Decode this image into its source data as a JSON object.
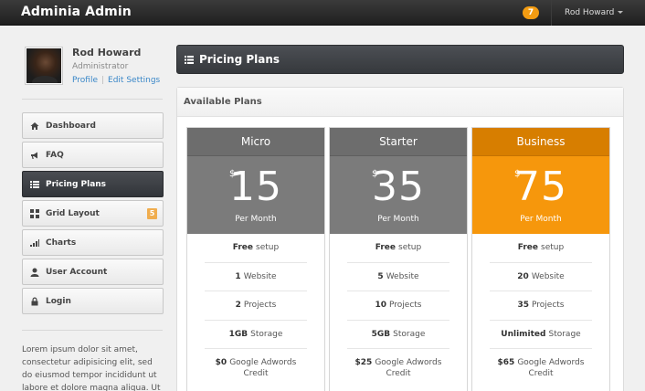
{
  "app": {
    "brand": "Adminia Admin",
    "notifications": "7",
    "user_menu": "Rod Howard"
  },
  "profile": {
    "name": "Rod Howard",
    "role": "Administrator",
    "link_profile": "Profile",
    "link_edit": "Edit Settings"
  },
  "sidebar": {
    "items": [
      {
        "label": "Dashboard",
        "icon": "home-icon"
      },
      {
        "label": "FAQ",
        "icon": "bullhorn-icon"
      },
      {
        "label": "Pricing Plans",
        "icon": "list-icon",
        "active": true
      },
      {
        "label": "Grid Layout",
        "icon": "grid-icon",
        "badge": "5"
      },
      {
        "label": "Charts",
        "icon": "signal-icon"
      },
      {
        "label": "User Account",
        "icon": "user-icon"
      },
      {
        "label": "Login",
        "icon": "lock-icon"
      }
    ],
    "lorem": "Lorem ipsum dolor sit amet, consectetur adipisicing elit, sed do eiusmod tempor incididunt ut labore et dolore magna aliqua. Ut"
  },
  "main": {
    "title": "Pricing Plans",
    "panel_title": "Available Plans",
    "plans": [
      {
        "name": "Micro",
        "currency": "$",
        "amount": "15",
        "period": "Per Month",
        "features": [
          {
            "bold": "Free",
            "text": "setup"
          },
          {
            "bold": "1",
            "text": "Website"
          },
          {
            "bold": "2",
            "text": "Projects"
          },
          {
            "bold": "1GB",
            "text": "Storage"
          },
          {
            "bold": "$0",
            "text": "Google Adwords Credit"
          }
        ]
      },
      {
        "name": "Starter",
        "currency": "$",
        "amount": "35",
        "period": "Per Month",
        "features": [
          {
            "bold": "Free",
            "text": "setup"
          },
          {
            "bold": "5",
            "text": "Website"
          },
          {
            "bold": "10",
            "text": "Projects"
          },
          {
            "bold": "5GB",
            "text": "Storage"
          },
          {
            "bold": "$25",
            "text": "Google Adwords Credit"
          }
        ]
      },
      {
        "name": "Business",
        "currency": "$",
        "amount": "75",
        "period": "Per Month",
        "featured": true,
        "features": [
          {
            "bold": "Free",
            "text": "setup"
          },
          {
            "bold": "20",
            "text": "Website"
          },
          {
            "bold": "35",
            "text": "Projects"
          },
          {
            "bold": "Unlimited",
            "text": "Storage"
          },
          {
            "bold": "$65",
            "text": "Google Adwords Credit"
          }
        ]
      }
    ]
  },
  "colors": {
    "accent": "#f6970c",
    "accent_dark": "#d77e00",
    "nav_dark": "#32353a",
    "link": "#3a87c8"
  }
}
